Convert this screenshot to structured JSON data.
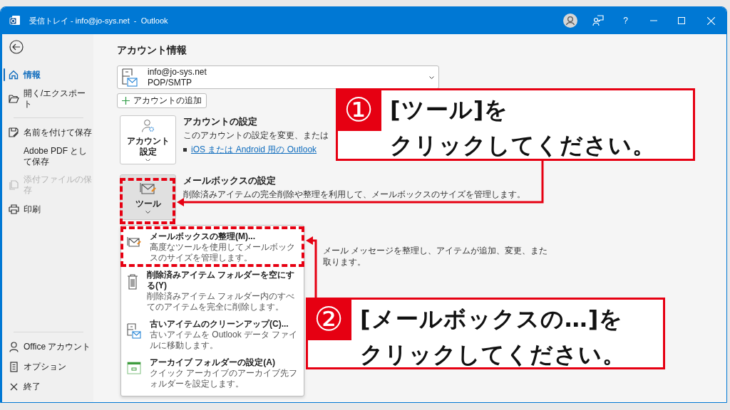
{
  "window": {
    "title": "受信トレイ - info@jo-sys.net  -  Outlook",
    "help_label": "?"
  },
  "sidebar": {
    "top_items": [
      {
        "kind": "home",
        "label": "情報",
        "selected": true,
        "disabled": false
      },
      {
        "kind": "folder",
        "label": "開く/エクスポート",
        "selected": false,
        "disabled": false
      }
    ],
    "middle_items": [
      {
        "kind": "save",
        "label": "名前を付けて保存",
        "selected": false,
        "disabled": false
      },
      {
        "kind": "plain",
        "label": "Adobe PDF として保存",
        "selected": false,
        "disabled": false
      },
      {
        "kind": "attachment",
        "label": "添付ファイルの保存",
        "selected": false,
        "disabled": true
      },
      {
        "kind": "print",
        "label": "印刷",
        "selected": false,
        "disabled": false
      }
    ],
    "bottom_items": [
      {
        "kind": "person",
        "label": "Office アカウント",
        "selected": false,
        "disabled": false
      },
      {
        "kind": "options",
        "label": "オプション",
        "selected": false,
        "disabled": false
      },
      {
        "kind": "exit",
        "label": "終了",
        "selected": false,
        "disabled": false
      }
    ]
  },
  "page": {
    "title": "アカウント情報",
    "account": {
      "email": "info@jo-sys.net",
      "type": "POP/SMTP"
    },
    "add_account_label": "アカウントの追加",
    "sections": [
      {
        "kind": "account",
        "button_lines": [
          "アカウント",
          "設定"
        ],
        "title": "アカウントの設定",
        "description": "このアカウントの設定を変更、または",
        "link": "iOS または Android 用の Outlook"
      },
      {
        "kind": "tools",
        "button_lines": [
          "ツール"
        ],
        "title": "メールボックスの設定",
        "description": "削除済みアイテムの完全削除や整理を利用して、メールボックスのサイズを管理します。"
      }
    ],
    "covered_lines": [
      "メール メッセージを整理し、アイテムが追加、変更、また",
      "取ります。"
    ]
  },
  "tools_menu": {
    "items": [
      {
        "kind": "mailbox",
        "title": "メールボックスの整理(M)...",
        "description": "高度なツールを使用してメールボックスのサイズを管理します。"
      },
      {
        "kind": "trash",
        "title": "削除済みアイテム フォルダーを空にする(Y)",
        "description": "削除済みアイテム フォルダー内のすべてのアイテムを完全に削除します。"
      },
      {
        "kind": "cleanup",
        "title": "古いアイテムのクリーンアップ(C)...",
        "description": "古いアイテムを Outlook データ ファイルに移動します。"
      },
      {
        "kind": "archive",
        "title": "アーカイブ フォルダーの設定(A)",
        "description": "クイック アーカイブのアーカイブ先フォルダーを設定します。"
      }
    ]
  },
  "callouts": [
    {
      "number": "①",
      "lines": [
        "[ツール]を",
        "クリックしてください。"
      ]
    },
    {
      "number": "②",
      "lines": [
        "[メールボックスの…]を",
        "クリックしてください。"
      ]
    }
  ]
}
